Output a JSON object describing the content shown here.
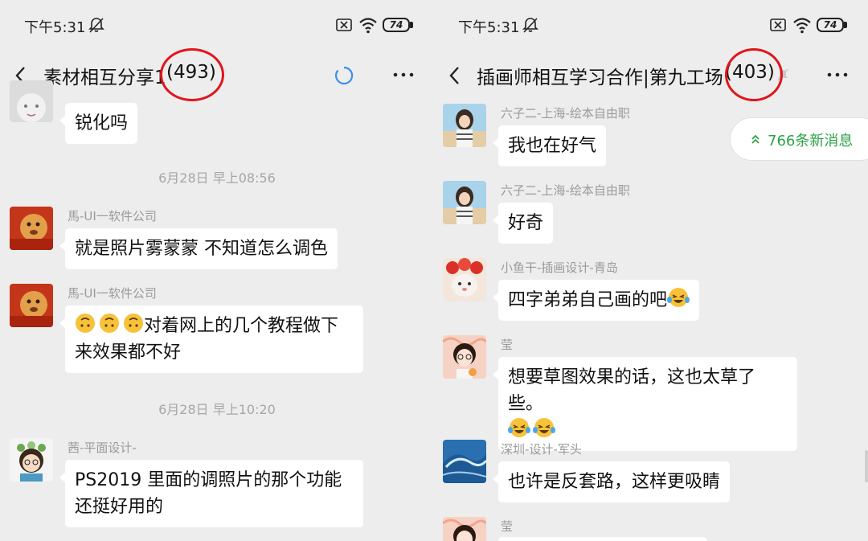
{
  "status_bar": {
    "time": "下午5:31",
    "battery": "74"
  },
  "left": {
    "title": "素材相互分享1",
    "count": "(493)",
    "messages": [
      {
        "text": "锐化吗"
      },
      {
        "timestamp": "6月28日 早上08:56"
      },
      {
        "sender": "馬-UI一软件公司",
        "text": "就是照片雾蒙蒙 不知道怎么调色"
      },
      {
        "sender": "馬-UI一软件公司",
        "text": "对着网上的几个教程做下来效果都不好",
        "line1": "对着网上的几个教程做下",
        "line2": "来效果都不好"
      },
      {
        "timestamp": "6月28日 早上10:20"
      },
      {
        "sender": "茜-平面设计-",
        "line1": "PS2019 里面的调照片的那个功能",
        "line2": "还挺好用的"
      }
    ]
  },
  "right": {
    "title": "插画师相互学习合作|第九工场",
    "count": "(403)",
    "new_messages": "766条新消息",
    "messages": [
      {
        "sender": "六子二-上海-绘本自由职",
        "text": "我也在好气"
      },
      {
        "sender": "六子二-上海-绘本自由职",
        "text": "好奇"
      },
      {
        "sender": "小鱼干-插画设计-青岛",
        "text": "四字弟弟自己画的吧"
      },
      {
        "sender": "莹",
        "line1": "想要草图效果的话，这也太草了些。"
      },
      {
        "sender": "深圳-设计-军头",
        "text": "也许是反套路，这样更吸睛"
      },
      {
        "sender": "莹"
      }
    ]
  },
  "icons": {
    "bell": "bell-mute-icon",
    "x": "close-box-icon",
    "wifi": "wifi-icon",
    "back": "chevron-left-icon",
    "loading": "loading-spinner-icon",
    "more": "more-dots-icon",
    "new_messages": "double-chevron-up-icon",
    "mute": "mute-icon"
  },
  "colors": {
    "background": "#ededed",
    "bubble": "#ffffff",
    "annotation": "#e0161c",
    "new_messages_accent": "#2ba245",
    "spinner": "#3b8fe8"
  }
}
